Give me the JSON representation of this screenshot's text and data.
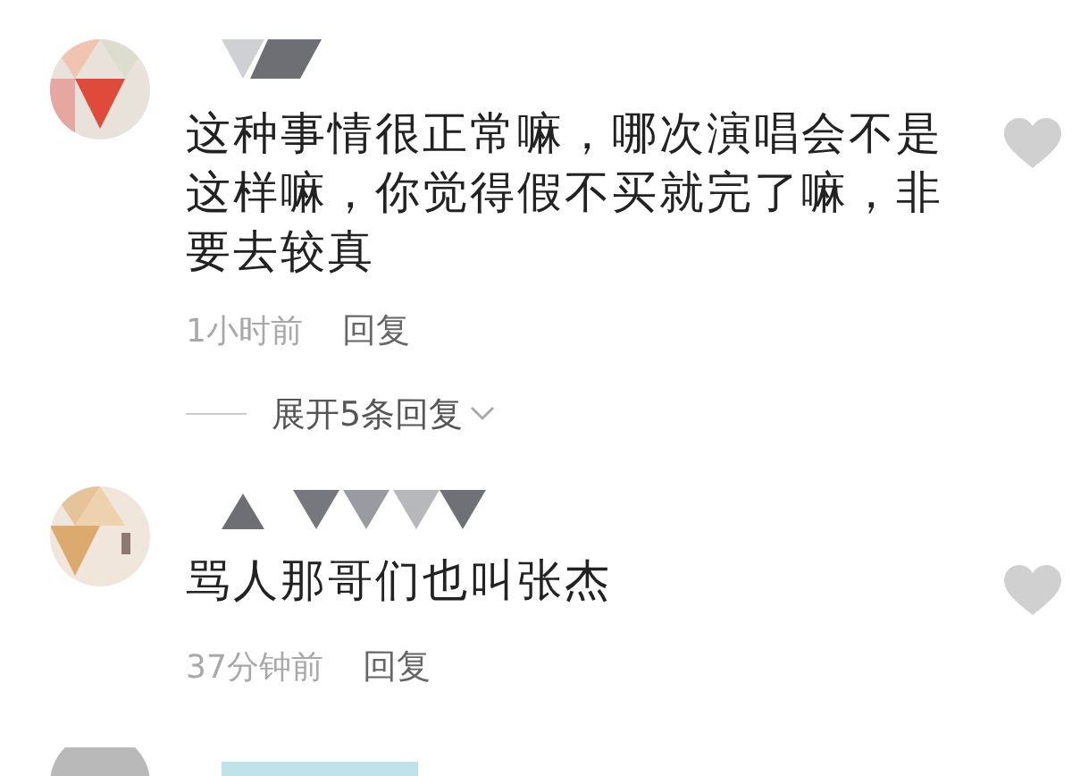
{
  "comments": [
    {
      "text": "这种事情很正常嘛，哪次演唱会不是这样嘛，你觉得假不买就完了嘛，非要去较真",
      "time": "1小时前",
      "reply": "回复",
      "liked": false,
      "expand": "展开5条回复"
    },
    {
      "text": "骂人那哥们也叫张杰",
      "time": "37分钟前",
      "reply": "回复",
      "liked": false
    }
  ]
}
